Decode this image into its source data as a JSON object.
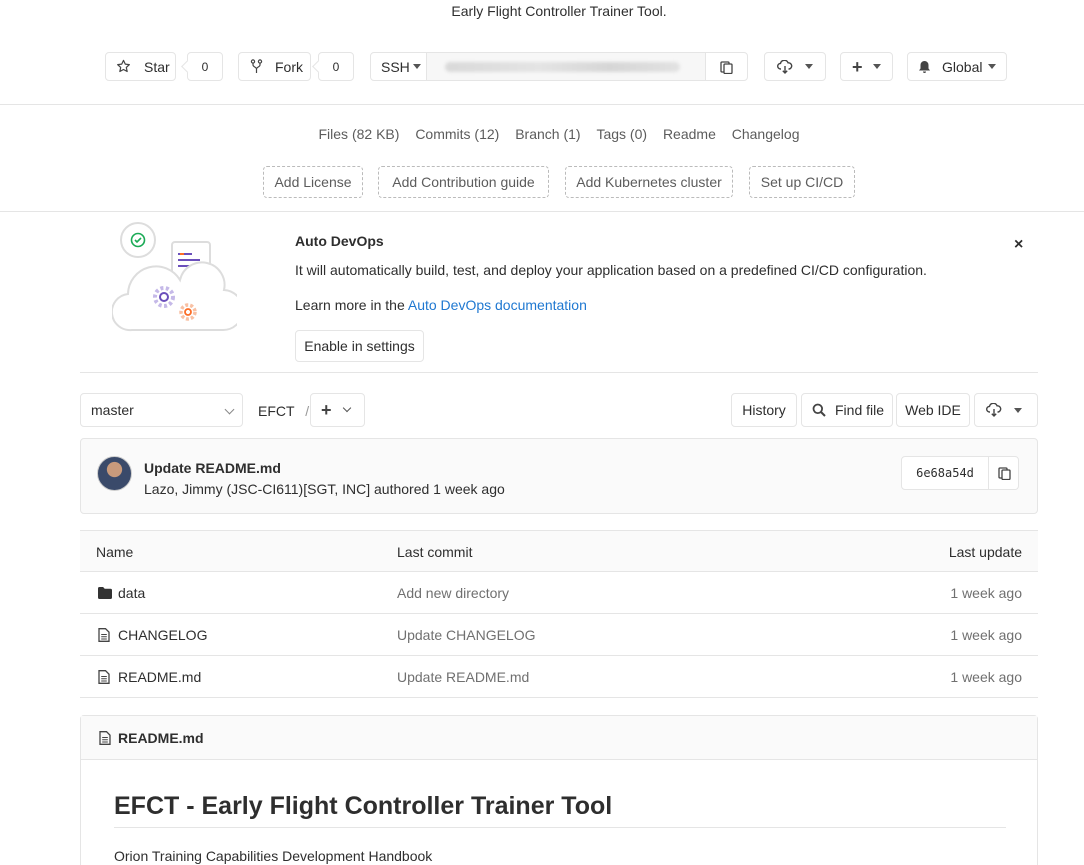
{
  "project": {
    "description": "Early Flight Controller Trainer Tool.",
    "star_label": "Star",
    "star_count": "0",
    "fork_label": "Fork",
    "fork_count": "0",
    "clone_protocol": "SSH",
    "notification_label": "Global"
  },
  "stats": {
    "files": "Files (82 KB)",
    "commits": "Commits (12)",
    "branch": "Branch (1)",
    "tags": "Tags (0)",
    "readme": "Readme",
    "changelog": "Changelog"
  },
  "quick_actions": [
    "Add License",
    "Add Contribution guide",
    "Add Kubernetes cluster",
    "Set up CI/CD"
  ],
  "auto_devops": {
    "title": "Auto DevOps",
    "text": "It will automatically build, test, and deploy your application based on a predefined CI/CD configuration.",
    "learn_prefix": "Learn more in the ",
    "learn_link": "Auto DevOps documentation",
    "button": "Enable in settings",
    "close": "×"
  },
  "repo_nav": {
    "branch": "master",
    "path_root": "EFCT",
    "separator": "/",
    "history": "History",
    "find_file": "Find file",
    "web_ide": "Web IDE"
  },
  "last_commit": {
    "title": "Update README.md",
    "author_line": "Lazo, Jimmy (JSC-CI611)[SGT, INC] authored 1 week ago",
    "sha": "6e68a54d"
  },
  "files_table": {
    "headers": {
      "name": "Name",
      "last_commit": "Last commit",
      "last_update": "Last update"
    },
    "rows": [
      {
        "name": "data",
        "type": "folder",
        "commit": "Add new directory",
        "updated": "1 week ago"
      },
      {
        "name": "CHANGELOG",
        "type": "file",
        "commit": "Update CHANGELOG",
        "updated": "1 week ago"
      },
      {
        "name": "README.md",
        "type": "file",
        "commit": "Update README.md",
        "updated": "1 week ago"
      }
    ]
  },
  "readme": {
    "file_name": "README.md",
    "heading": "EFCT - Early Flight Controller Trainer Tool",
    "first_line": "Orion Training Capabilities Development Handbook"
  },
  "colors": {
    "link": "#1f78d1",
    "border": "#e5e5e5",
    "panel_bg": "#fafafa"
  }
}
